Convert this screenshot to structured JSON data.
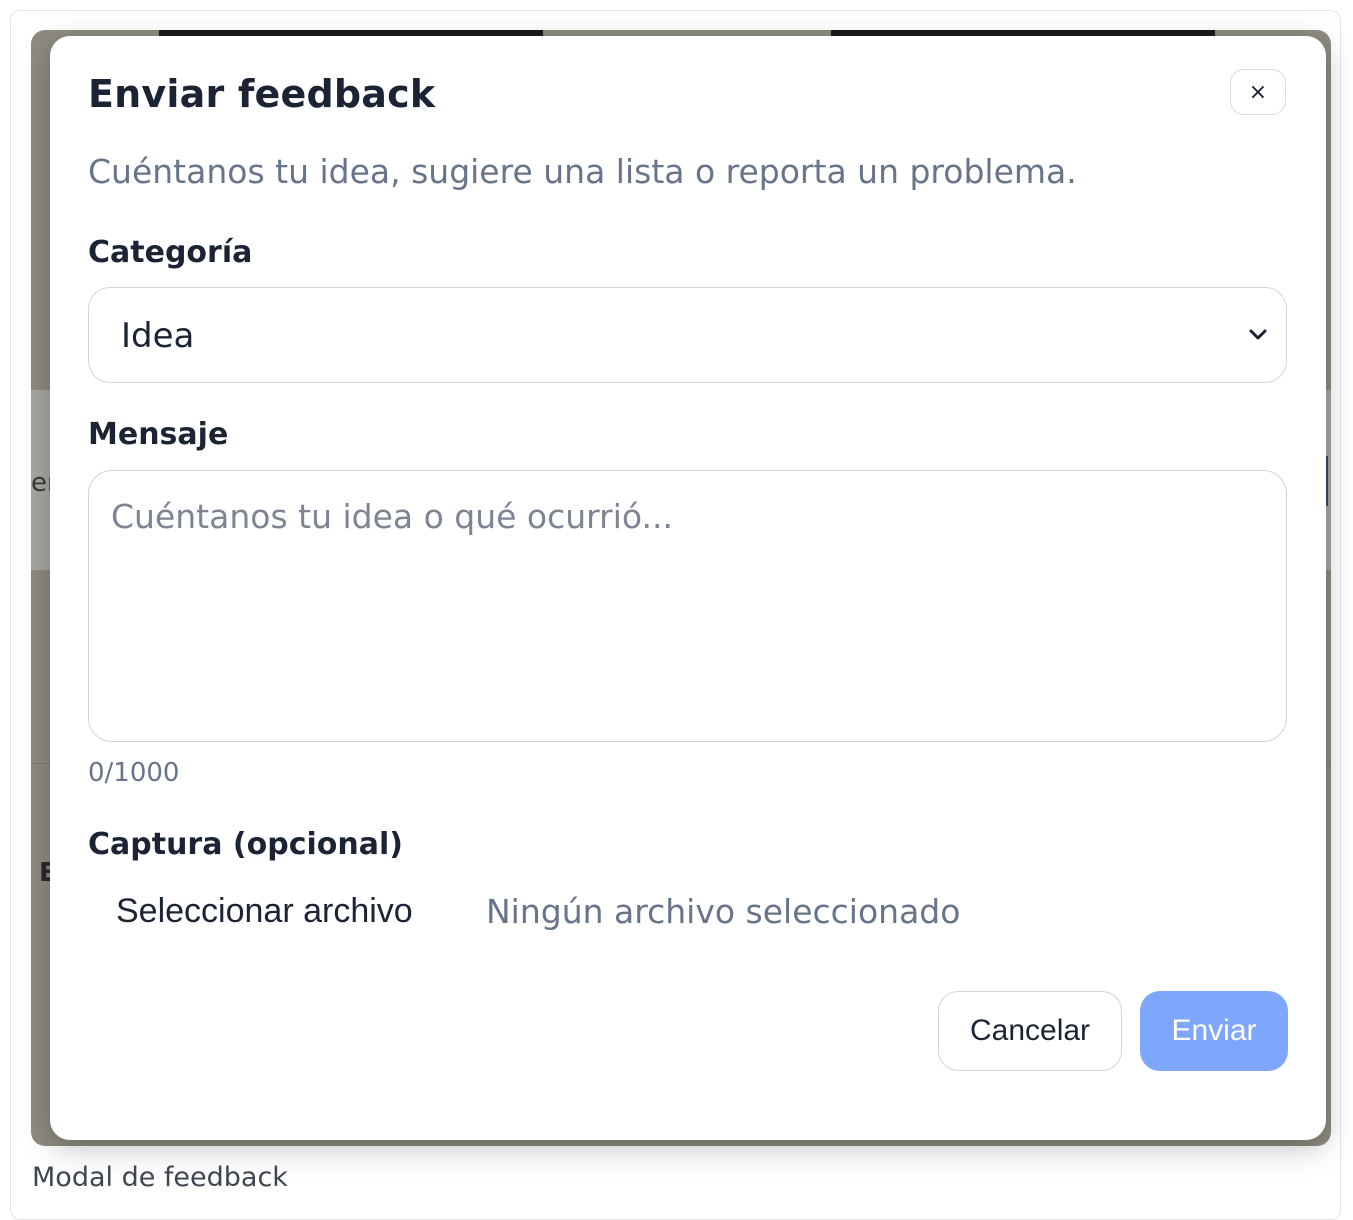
{
  "modal": {
    "title": "Enviar feedback",
    "close_label": "×",
    "subtitle": "Cuéntanos tu idea, sugiere una lista o reporta un problema.",
    "category": {
      "label": "Categoría",
      "selected": "Idea",
      "icon": "chevron-down-icon"
    },
    "message": {
      "label": "Mensaje",
      "placeholder": "Cuéntanos tu idea o qué ocurrió...",
      "value": "",
      "counter": "0/1000"
    },
    "attachment": {
      "label": "Captura (opcional)",
      "button_label": "Seleccionar archivo",
      "status": "Ningún archivo seleccionado"
    },
    "actions": {
      "cancel_label": "Cancelar",
      "submit_label": "Enviar"
    }
  },
  "background_fragments": {
    "left_text": "er",
    "left_bold": "E"
  },
  "caption": "Modal de feedback",
  "colors": {
    "submit_button": "#7ea6fb",
    "overlay": "#8e8c80",
    "title_text": "#1b2434",
    "muted_text": "#67758a"
  }
}
